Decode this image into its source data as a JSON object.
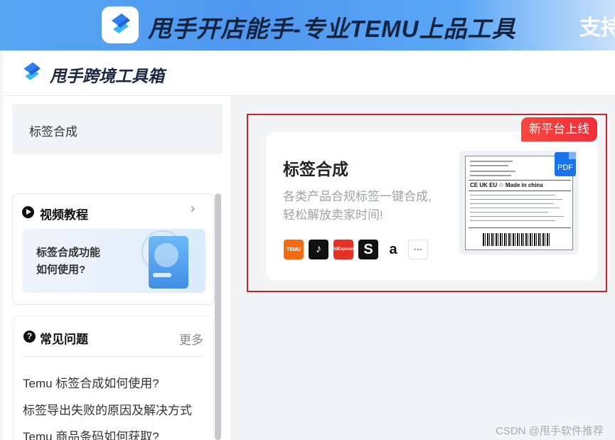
{
  "banner": {
    "title": "甩手开店能手-专业TEMU上品工具",
    "right_text": "支持"
  },
  "header": {
    "app_title": "甩手跨境工具箱"
  },
  "sidebar": {
    "active_item": "标签合成",
    "video_tutorial": {
      "title": "视频教程",
      "thumb_line1": "标签合成功能",
      "thumb_line2": "如何使用?"
    },
    "faq": {
      "title": "常见问题",
      "more": "更多",
      "items": [
        "Temu 标签合成如何使用?",
        "标签导出失败的原因及解决方式",
        "Temu 商品条码如何获取?"
      ]
    }
  },
  "tool_card": {
    "badge": "新平台上线",
    "name": "标签合成",
    "desc_line1": "各类产品合规标签一键合成,",
    "desc_line2": "轻松解放卖家时间!",
    "platforms": [
      "TEMU",
      "TikTok",
      "AliExpress",
      "Shopee",
      "Amazon",
      "更多"
    ],
    "label_preview_marks": "CE  UK  EU  ♲  Made in china",
    "pdf_label": "PDF"
  },
  "watermark": "CSDN @甩手软件推荐",
  "colors": {
    "banner_blue": "#4f97f0",
    "highlight_red": "#c0262b",
    "badge_red": "#f9473f"
  }
}
